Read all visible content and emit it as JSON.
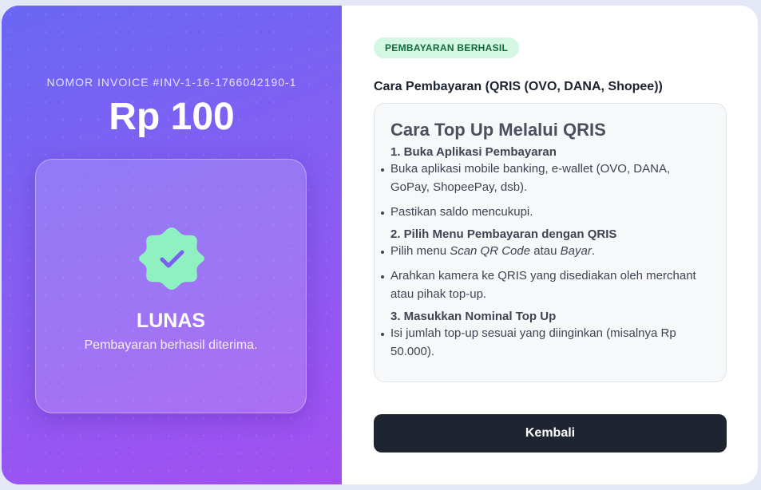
{
  "invoice": {
    "label": "NOMOR INVOICE #INV-1-16-1766042190-1",
    "amount": "Rp 100"
  },
  "status": {
    "icon": "check-badge-icon",
    "title": "LUNAS",
    "subtitle": "Pembayaran berhasil diterima."
  },
  "payment": {
    "badge": "PEMBAYARAN BERHASIL",
    "method_title": "Cara Pembayaran (QRIS (OVO, DANA, Shopee))"
  },
  "instructions": {
    "title": "Cara Top Up Melalui QRIS",
    "steps": [
      {
        "title": "1. Buka Aplikasi Pembayaran",
        "bullets": [
          "Buka aplikasi mobile banking, e-wallet (OVO, DANA, GoPay, ShopeePay, dsb).",
          "Pastikan saldo mencukupi."
        ]
      },
      {
        "title": "2. Pilih Menu Pembayaran dengan QRIS",
        "bullets": [
          {
            "pre": "Pilih menu ",
            "em1": "Scan QR Code",
            "mid": " atau ",
            "em2": "Bayar",
            "post": "."
          },
          "Arahkan kamera ke QRIS yang disediakan oleh merchant atau pihak top-up."
        ]
      },
      {
        "title": "3. Masukkan Nominal Top Up",
        "bullets": [
          "Isi jumlah top-up sesuai yang diinginkan (misalnya Rp 50.000)."
        ]
      }
    ]
  },
  "actions": {
    "back_label": "Kembali"
  },
  "colors": {
    "gradient_start": "#6a67f4",
    "gradient_end": "#a34ff0",
    "success_badge_bg": "#d3f7e2",
    "success_badge_text": "#136a3c",
    "badge_icon": "#8ff0c2",
    "button_bg": "#1f2530"
  }
}
